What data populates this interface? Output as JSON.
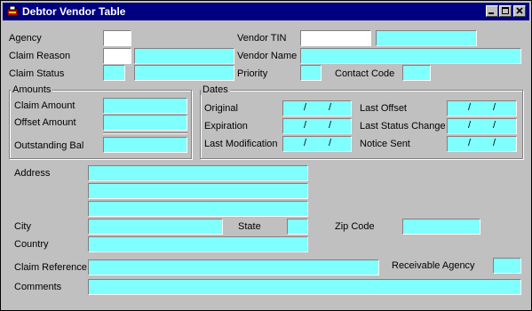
{
  "window": {
    "title": "Debtor Vendor Table"
  },
  "labels": {
    "agency": "Agency",
    "claim_reason": "Claim Reason",
    "claim_status": "Claim Status",
    "vendor_tin": "Vendor TIN",
    "vendor_name": "Vendor Name",
    "priority": "Priority",
    "contact_code": "Contact Code",
    "amounts_group": "Amounts",
    "claim_amount": "Claim Amount",
    "offset_amount": "Offset Amount",
    "outstanding_bal": "Outstanding Bal",
    "dates_group": "Dates",
    "original": "Original",
    "expiration": "Expiration",
    "last_modification": "Last Modification",
    "last_offset": "Last Offset",
    "last_status_change": "Last Status Change",
    "notice_sent": "Notice Sent",
    "address": "Address",
    "city": "City",
    "state": "State",
    "zip_code": "Zip Code",
    "country": "Country",
    "claim_reference": "Claim Reference",
    "receivable_agency": "Receivable Agency",
    "comments": "Comments"
  },
  "date_separator": "/",
  "colors": {
    "field_cyan": "#80ffff",
    "field_white": "#ffffff",
    "titlebar": "#000080"
  },
  "icons": {
    "app": "debtor-app-icon",
    "minimize": "minimize-icon",
    "maximize": "maximize-icon",
    "close": "close-icon"
  }
}
